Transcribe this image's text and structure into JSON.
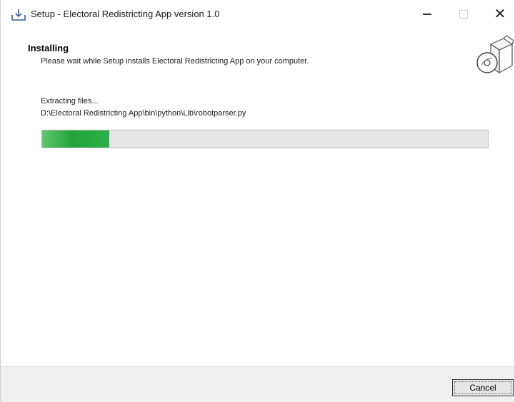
{
  "window": {
    "title": "Setup - Electoral Redistricting App version 1.0",
    "controls": {
      "minimize": "minimize",
      "maximize": "maximize",
      "close": "✕"
    }
  },
  "header": {
    "title": "Installing",
    "subtitle": "Please wait while Setup installs Electoral Redistricting App on your computer."
  },
  "body": {
    "status": "Extracting files...",
    "current_file": "D:\\Electoral Redistricting App\\bin\\python\\Lib\\robotparser.py",
    "progress_fraction": 0.15
  },
  "footer": {
    "cancel_label": "Cancel"
  },
  "colors": {
    "progress_fill": "#24a33a",
    "progress_track": "#e6e6e6",
    "footer_bg": "#f0f0f0"
  },
  "icons": [
    "installer-icon",
    "minimize-icon",
    "maximize-icon",
    "close-icon",
    "software-box-icon"
  ]
}
